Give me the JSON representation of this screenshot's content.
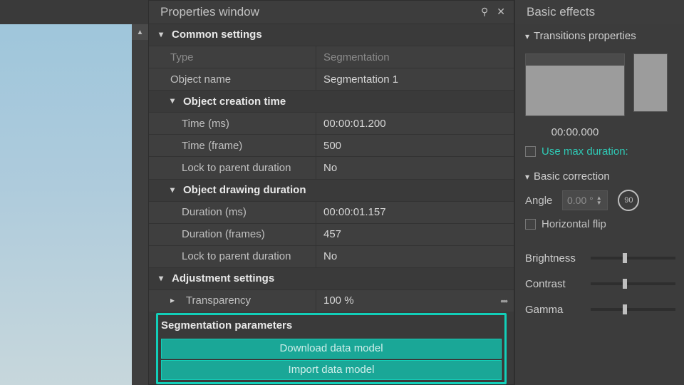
{
  "preview": {},
  "properties": {
    "title": "Properties window",
    "groups": {
      "common": {
        "label": "Common settings"
      },
      "type": {
        "label": "Type",
        "value": "Segmentation"
      },
      "name": {
        "label": "Object name",
        "value": "Segmentation 1"
      },
      "creation": {
        "label": "Object creation time"
      },
      "time_ms": {
        "label": "Time (ms)",
        "value": "00:00:01.200"
      },
      "time_fr": {
        "label": "Time (frame)",
        "value": "500"
      },
      "lock_creation": {
        "label": "Lock to parent duration",
        "value": "No"
      },
      "drawing": {
        "label": "Object drawing duration"
      },
      "dur_ms": {
        "label": "Duration (ms)",
        "value": "00:00:01.157"
      },
      "dur_fr": {
        "label": "Duration (frames)",
        "value": "457"
      },
      "lock_drawing": {
        "label": "Lock to parent duration",
        "value": "No"
      },
      "adjust": {
        "label": "Adjustment settings"
      },
      "transp": {
        "label": "Transparency",
        "value": "100 %"
      },
      "segparams": {
        "label": "Segmentation parameters"
      },
      "download_btn": "Download data model",
      "import_btn": "Import data model"
    }
  },
  "effects": {
    "title": "Basic effects",
    "transitions": {
      "label": "Transitions properties",
      "time": "00:00.000"
    },
    "use_max": "Use max duration:",
    "basic_correction": "Basic correction",
    "angle": {
      "label": "Angle",
      "value": "0.00 °",
      "rotate": "90"
    },
    "hflip": "Horizontal flip",
    "sliders": {
      "brightness": "Brightness",
      "contrast": "Contrast",
      "gamma": "Gamma"
    }
  }
}
